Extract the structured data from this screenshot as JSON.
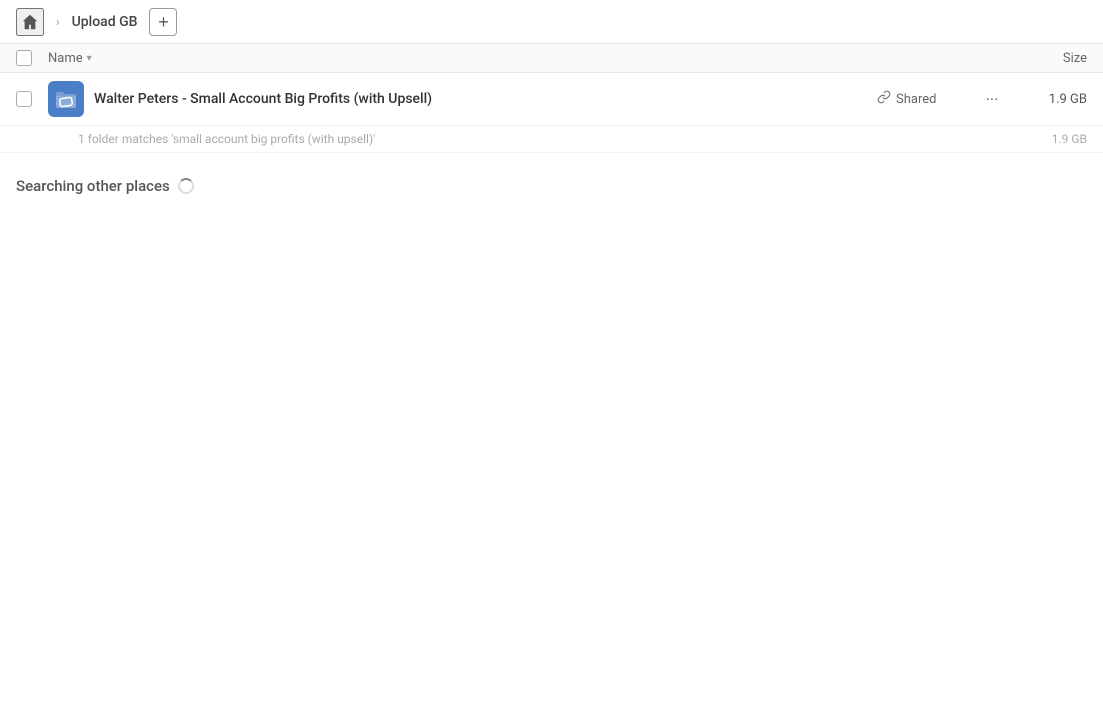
{
  "toolbar": {
    "breadcrumb": "Upload GB",
    "add_button_label": "+"
  },
  "column_headers": {
    "name_label": "Name",
    "size_label": "Size"
  },
  "file_row": {
    "name": "Walter Peters - Small Account Big Profits (with Upsell)",
    "shared_label": "Shared",
    "more_label": "···",
    "size": "1.9 GB"
  },
  "summary": {
    "text": "1 folder matches 'small account big profits (with upsell)'",
    "size": "1.9 GB"
  },
  "searching": {
    "label": "Searching other places"
  }
}
